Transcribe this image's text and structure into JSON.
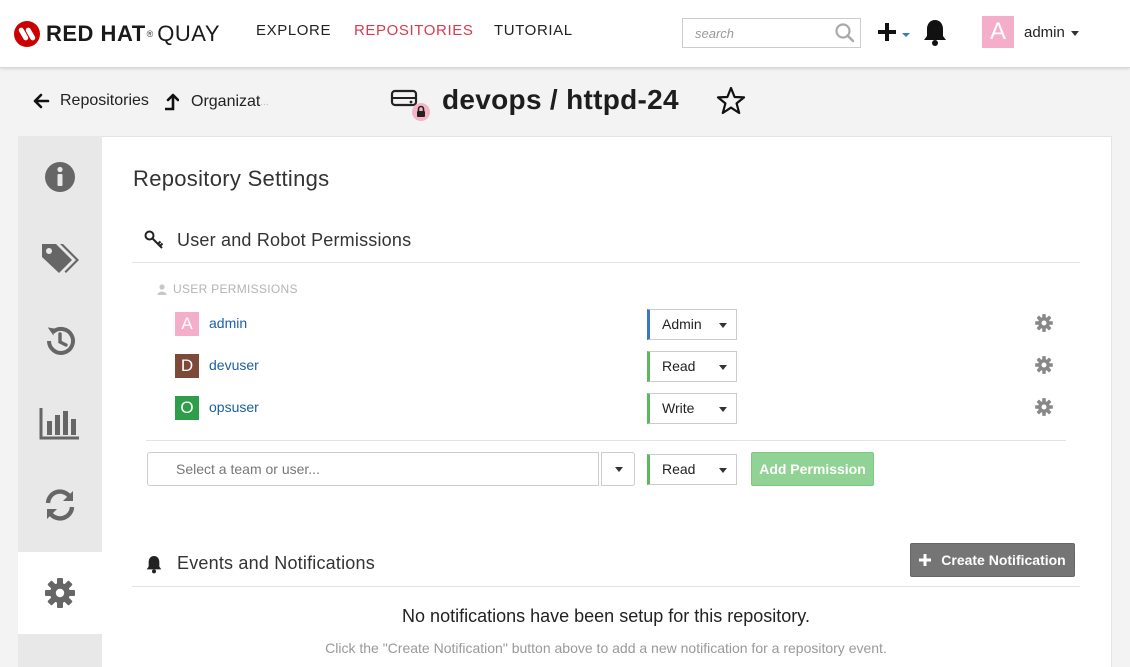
{
  "brand": {
    "name": "RED HAT",
    "registered": "®",
    "product": "QUAY",
    "accent": "#cc0000"
  },
  "nav": [
    {
      "label": "EXPLORE"
    },
    {
      "label": "REPOSITORIES",
      "active": true
    },
    {
      "label": "TUTORIAL"
    }
  ],
  "search": {
    "placeholder": "search",
    "value": ""
  },
  "user": {
    "initial": "A",
    "name": "admin",
    "avatar_color": "#f5aec9"
  },
  "breadcrumb": {
    "back_label": "Repositories",
    "up_label": "Organizat",
    "up_label_fade": "..."
  },
  "repo": {
    "title": "devops / httpd-24",
    "private": true
  },
  "sidebar": {
    "items": [
      {
        "icon": "info-icon"
      },
      {
        "icon": "tags-icon"
      },
      {
        "icon": "history-icon"
      },
      {
        "icon": "usage-chart-icon"
      },
      {
        "icon": "builds-sync-icon"
      },
      {
        "icon": "settings-gear-icon",
        "active": true
      }
    ]
  },
  "settings": {
    "heading": "Repository Settings",
    "permissions": {
      "title": "User and Robot Permissions",
      "group_label": "USER PERMISSIONS",
      "rows": [
        {
          "initial": "A",
          "name": "admin",
          "role": "Admin",
          "avatar_color": "#f5aec9",
          "role_color": "#3a78c3"
        },
        {
          "initial": "D",
          "name": "devuser",
          "role": "Read",
          "avatar_color": "#7d4a3a",
          "role_color": "#5cb85c"
        },
        {
          "initial": "O",
          "name": "opsuser",
          "role": "Write",
          "avatar_color": "#2f9e4a",
          "role_color": "#5cb85c"
        }
      ],
      "add": {
        "placeholder": "Select a team or user...",
        "role": "Read",
        "button_label": "Add Permission"
      }
    },
    "notifications": {
      "title": "Events and Notifications",
      "create_label": "Create Notification",
      "empty_message": "No notifications have been setup for this repository.",
      "empty_hint": "Click the \"Create Notification\" button above to add a new notification for a repository event."
    }
  }
}
